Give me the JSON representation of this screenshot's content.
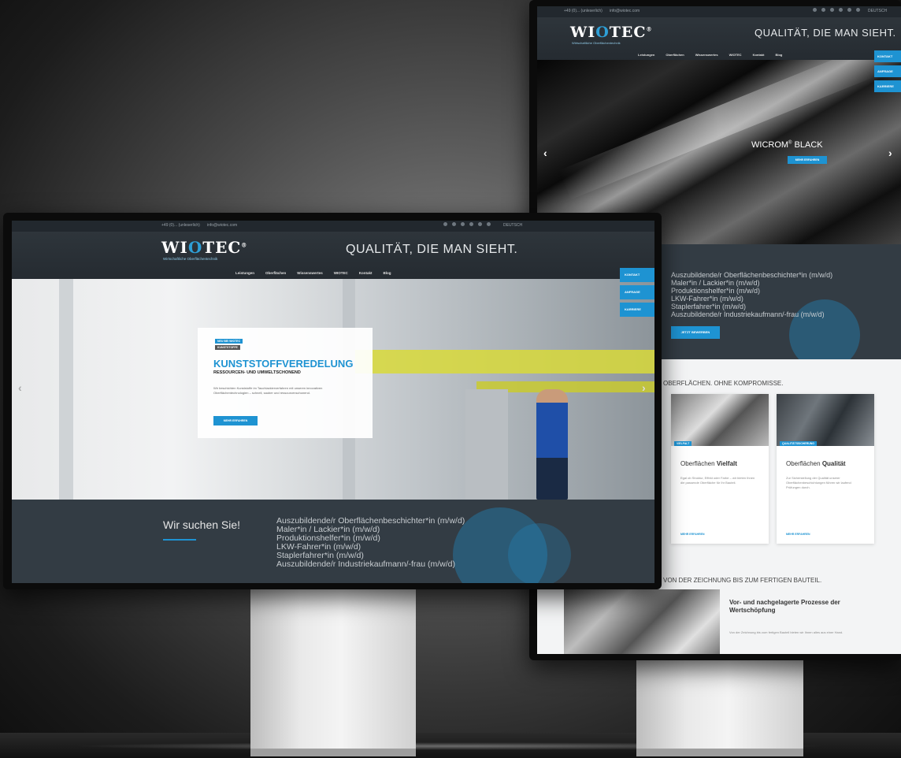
{
  "brand": {
    "logo_text_1": "WI",
    "logo_o": "O",
    "logo_text_2": "TEC",
    "logo_registered": "®",
    "tagline": "Wirtschaftliche Oberflächentechnik",
    "claim": "QUALITÄT, DIE MAN SIEHT.",
    "accent_color": "#1e93d2"
  },
  "topbar": {
    "phone": "+49 (0)... (unleserlich)",
    "email": "info@wiotec.com",
    "language": "DEUTSCH",
    "social_icons": [
      "facebook-icon",
      "xing-icon",
      "twitter-icon",
      "youtube-icon",
      "pinterest-icon",
      "mail-icon"
    ]
  },
  "nav": {
    "items": [
      "Leistungen",
      "Oberflächen",
      "Wissenswertes",
      "WIOTEC",
      "Kontakt",
      "Blog"
    ]
  },
  "side_buttons": [
    "KONTAKT",
    "ANFRAGE",
    "KARRIERE"
  ],
  "front_hero": {
    "badge_1": "NEU BEI WIOTEC",
    "badge_2": "KUNSTSTOFFE",
    "title": "KUNSTSTOFFVEREDELUNG",
    "subtitle": "RESSOURCEN- UND UMWELTSCHONEND",
    "text": "Wir beschichten Kunststoffe im Tauchlackierverfahren mit unseren innovativen Oberflächentechnologien – schnell, sauber und ressourcenschonend.",
    "button": "MEHR ERFAHREN"
  },
  "jobs": {
    "title": "Wir suchen Sie!",
    "list": [
      "Auszubildende/r Oberflächenbeschichter*in (m/w/d)",
      "Maler*in / Lackier*in (m/w/d)",
      "Produktionshelfer*in (m/w/d)",
      "LKW-Fahrer*in (m/w/d)",
      "Staplerfahrer*in (m/w/d)",
      "Auszubildende/r Industriekaufmann/-frau (m/w/d)"
    ],
    "button": "JETZT BEWERBEN"
  },
  "back_hero": {
    "title": "WICROM",
    "registered": "®",
    "title_suffix": " BLACK",
    "button": "MEHR ERFAHREN"
  },
  "back_sections": {
    "section_1_title": "OBERFLÄCHEN. OHNE KOMPROMISSE.",
    "card_1": {
      "tag": "VIELFALT",
      "title_plain": "Oberflächen ",
      "title_bold": "Vielfalt",
      "text": "Egal ob Struktur, Effekt oder Farbe – wir bieten Ihnen die passende Oberfläche für Ihr Bauteil.",
      "link": "MEHR ERFAHREN"
    },
    "card_2": {
      "tag": "QUALITÄTSSICHERUNG",
      "title_plain": "Oberflächen ",
      "title_bold": "Qualität",
      "text": "Zur Sicherstellung der Qualität unserer Oberflächenbeschichtungen führen wir laufend Prüfungen durch.",
      "link": "MEHR ERFAHREN"
    },
    "section_2_title": "VON DER ZEICHNUNG BIS ZUM FERTIGEN BAUTEIL.",
    "process_title": "Vor- und nachgelagerte Prozesse der Wertschöpfung",
    "process_text": "Von der Zeichnung bis zum fertigen Bauteil bieten wir Ihnen alles aus einer Hand."
  }
}
